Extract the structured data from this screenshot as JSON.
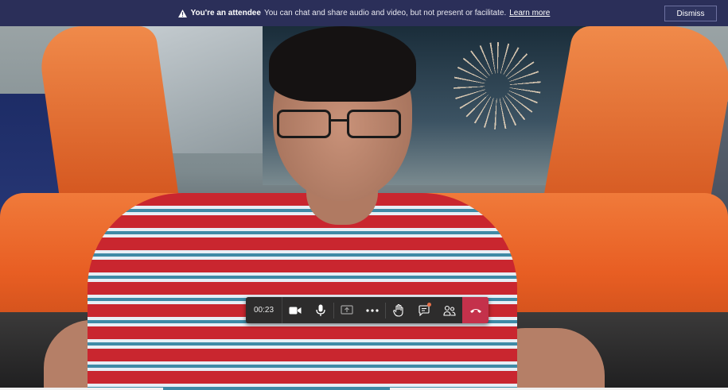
{
  "banner": {
    "title": "You're an attendee",
    "message": "You can chat and share audio and video, but not present or facilitate.",
    "link": "Learn more",
    "dismiss_label": "Dismiss",
    "icon": "warning-icon"
  },
  "controls": {
    "timer": "00:23",
    "buttons": [
      {
        "name": "camera",
        "icon": "video-camera-icon"
      },
      {
        "name": "microphone",
        "icon": "microphone-icon"
      },
      {
        "name": "share",
        "icon": "share-screen-icon",
        "disabled": true
      },
      {
        "name": "more",
        "icon": "more-actions-icon"
      },
      {
        "name": "raise-hand",
        "icon": "raise-hand-icon"
      },
      {
        "name": "chat",
        "icon": "chat-icon",
        "has_notification": true
      },
      {
        "name": "participants",
        "icon": "participants-icon"
      },
      {
        "name": "hang-up",
        "icon": "hang-up-icon"
      }
    ]
  },
  "colors": {
    "banner_bg": "#2b2f59",
    "controls_bg": "#2d2c2c",
    "hangup": "#c4314b",
    "notification_dot": "#e9714a"
  }
}
